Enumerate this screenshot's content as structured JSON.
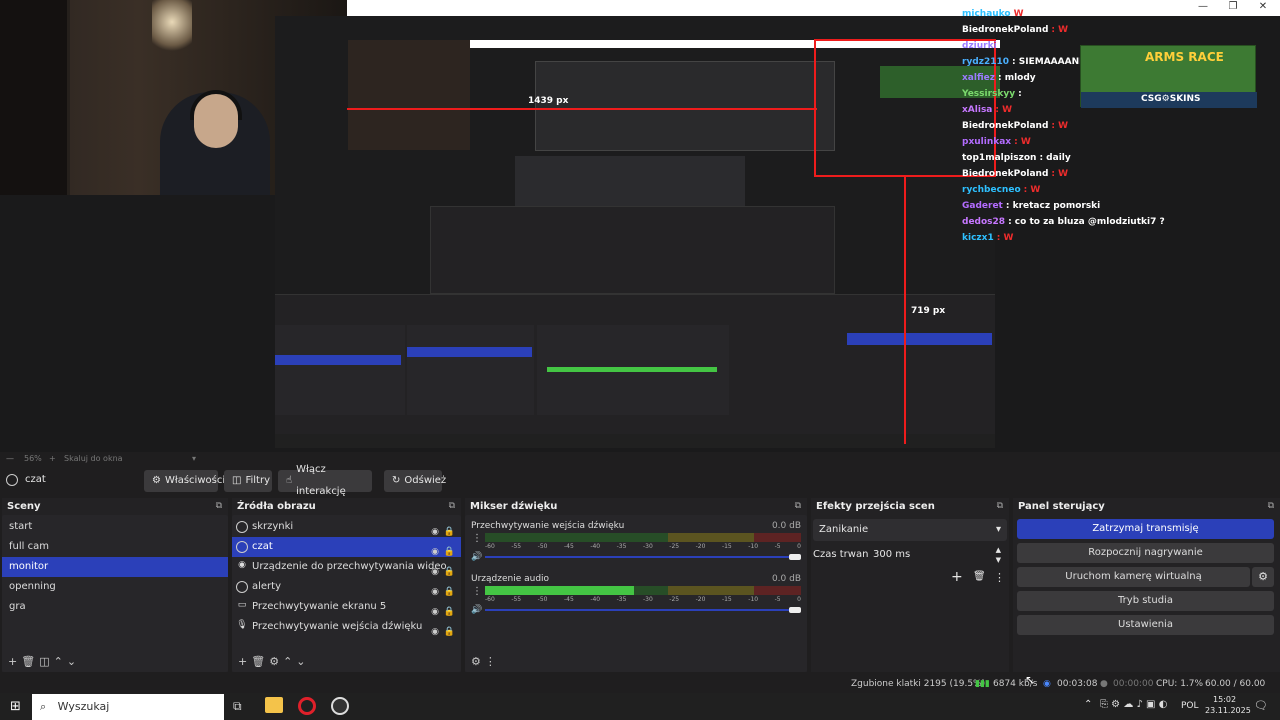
{
  "preview": {
    "measure_h": "1439 px",
    "measure_v": "719 px",
    "chat": [
      {
        "name": "michauko",
        "msg": "W",
        "color": "#2ec0ff"
      },
      {
        "name": "BiedronekPoland",
        "msg": ": W",
        "color": "#ffffff"
      },
      {
        "name": "dziurki",
        "msg": "",
        "color": "#9b7cff"
      },
      {
        "name": "rydz2110",
        "msg": ": SIEMAAAANKOOOO",
        "color": "#4ab0ff"
      },
      {
        "name": "xalfiez",
        "msg": ": mlody",
        "color": "#9b7cff"
      },
      {
        "name": "Yessirskyy",
        "msg": ":",
        "color": "#7bd96d"
      },
      {
        "name": "xAlisa",
        "msg": ": W",
        "color": "#c677ff"
      },
      {
        "name": "BiedronekPoland",
        "msg": ": W",
        "color": "#ffffff"
      },
      {
        "name": "pxulinkax",
        "msg": ": W",
        "color": "#b36cff"
      },
      {
        "name": "top1malpiszon",
        "msg": ": daily",
        "color": "#ffffff"
      },
      {
        "name": "BiedronekPoland",
        "msg": ": W",
        "color": "#ffffff"
      },
      {
        "name": "rychbecneo",
        "msg": ": W",
        "color": "#2ec0ff"
      },
      {
        "name": "Gaderet",
        "msg": ": kretacz pomorski",
        "color": "#b36cff"
      },
      {
        "name": "dedos28",
        "msg": ": co to za bluza @mlodziutki7 ?",
        "color": "#c677ff"
      },
      {
        "name": "kiczx1",
        "msg": ": W",
        "color": "#2ec0ff"
      }
    ],
    "ad_title": "ARMS RACE",
    "ad_brand": "CSG⚙SKINS"
  },
  "zoom": {
    "percent": "56%",
    "label": "Skaluj do okna"
  },
  "toolbar": {
    "scene_name": "czat",
    "properties": "Właściwości",
    "filters": "Filtry",
    "interact": "Włącz interakcję",
    "refresh": "Odśwież"
  },
  "scenes": {
    "title": "Sceny",
    "items": [
      {
        "label": "start",
        "selected": false
      },
      {
        "label": "full cam",
        "selected": false
      },
      {
        "label": "monitor",
        "selected": true
      },
      {
        "label": "openning",
        "selected": false
      },
      {
        "label": "gra",
        "selected": false
      }
    ]
  },
  "sources": {
    "title": "Źródła obrazu",
    "items": [
      {
        "label": "skrzynki",
        "icon": "browser-icon",
        "selected": false
      },
      {
        "label": "czat",
        "icon": "browser-icon",
        "selected": true
      },
      {
        "label": "Urządzenie do przechwytywania wideo",
        "icon": "camera-icon",
        "selected": false
      },
      {
        "label": "alerty",
        "icon": "browser-icon",
        "selected": false
      },
      {
        "label": "Przechwytywanie ekranu 5",
        "icon": "monitor-icon",
        "selected": false
      },
      {
        "label": "Przechwytywanie wejścia dźwięku",
        "icon": "mic-icon",
        "selected": false
      }
    ]
  },
  "mixer": {
    "title": "Mikser dźwięku",
    "channels": [
      {
        "name": "Przechwytywanie wejścia dźwięku",
        "db": "0.0 dB",
        "level": 0
      },
      {
        "name": "Urządzenie audio",
        "db": "0.0 dB",
        "level": 0.47
      }
    ],
    "ticks": [
      "-60",
      "-55",
      "-50",
      "-45",
      "-40",
      "-35",
      "-30",
      "-25",
      "-20",
      "-15",
      "-10",
      "-5",
      "0"
    ]
  },
  "transitions": {
    "title": "Efekty przejścia scen",
    "selected": "Zanikanie",
    "duration_label": "Czas trwania",
    "duration_value": "300 ms"
  },
  "controls": {
    "title": "Panel sterujący",
    "buttons": [
      "Zatrzymaj transmisję",
      "Rozpocznij nagrywanie",
      "Uruchom kamerę wirtualną",
      "Tryb studia",
      "Ustawienia"
    ]
  },
  "status": {
    "dropped": "Zgubione klatki 2195 (19.5%)",
    "bitrate": "6874 kb/s",
    "stream_time": "00:03:08",
    "rec_time": "00:00:00",
    "cpu": "CPU: 1.7%",
    "fps": "60.00 / 60.00 FPS"
  },
  "taskbar": {
    "search": "Wyszukaj",
    "lang": "POL",
    "time": "15:02",
    "date": "23.11.2025"
  },
  "colors": {
    "accent": "#2b40b9",
    "bg": "#1f1e1f",
    "panel": "#272629"
  }
}
